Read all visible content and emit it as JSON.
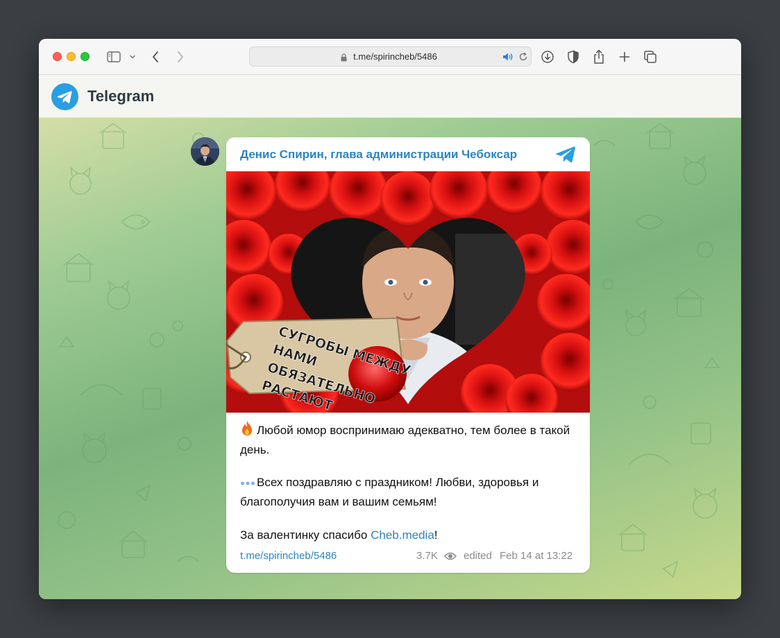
{
  "browser": {
    "url": "t.me/spirincheb/5486"
  },
  "header": {
    "title": "Telegram"
  },
  "post": {
    "channel_name": "Денис Спирин, глава администрации Чебоксар",
    "image_text": [
      "СУГРОБЫ МЕЖДУ",
      "НАМИ",
      "ОБЯЗАТЕЛЬНО",
      "РАСТАЮТ"
    ],
    "paragraph1": "Любой юмор воспринимаю адекватно, тем более в такой день.",
    "paragraph2": "Всех поздравляю с праздником! Любви, здоровья и благополучия вам и вашим семьям!",
    "paragraph3_prefix": "За валентинку спасибо ",
    "paragraph3_link": "Cheb.media",
    "paragraph3_suffix": "!",
    "post_link": "t.me/spirincheb/5486",
    "views": "3.7K",
    "edited_label": "edited",
    "date": "Feb 14 at 13:22"
  },
  "colors": {
    "accent": "#2b85c2",
    "telegram_blue": "#2a9ee3"
  },
  "icons": [
    "sidebar-icon",
    "chevron-down-icon",
    "back-icon",
    "forward-icon",
    "lock-icon",
    "speaker-icon",
    "reload-icon",
    "download-icon",
    "shield-icon",
    "share-icon",
    "plus-icon",
    "tabs-icon",
    "telegram-logo-icon",
    "fire-icon",
    "dots-icon",
    "eye-icon"
  ]
}
